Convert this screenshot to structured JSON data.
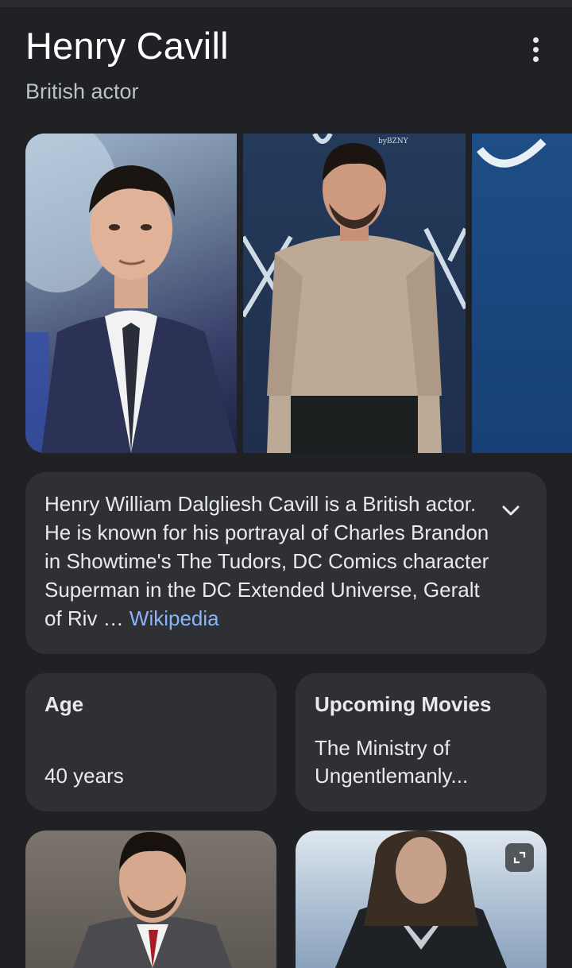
{
  "header": {
    "title": "Henry Cavill",
    "subtitle": "British actor",
    "more_icon": "more-vert-icon"
  },
  "gallery": {
    "photos": [
      {
        "alt": "Henry Cavill in suit"
      },
      {
        "alt": "Henry Cavill in sweater"
      },
      {
        "alt": "Henry Cavill partial"
      }
    ],
    "photo2_sign_text": "byBZNY"
  },
  "description": {
    "text": "Henry William Dalgliesh Cavill is a British actor. He is known for his portrayal of Charles Brandon in Showtime's The Tudors, DC Comics character Superman in the DC Extended Universe, Geralt of Riv …",
    "link_label": "Wikipedia",
    "expand_icon": "chevron-down-icon"
  },
  "facts": {
    "age": {
      "label": "Age",
      "value": "40 years"
    },
    "upcoming": {
      "label": "Upcoming Movies",
      "value": "The Ministry of Ungentlemanly..."
    }
  },
  "tiles": {
    "expand_icon": "expand-icon"
  },
  "colors": {
    "background": "#202124",
    "card": "#2f3033",
    "link": "#8ab4f8"
  }
}
